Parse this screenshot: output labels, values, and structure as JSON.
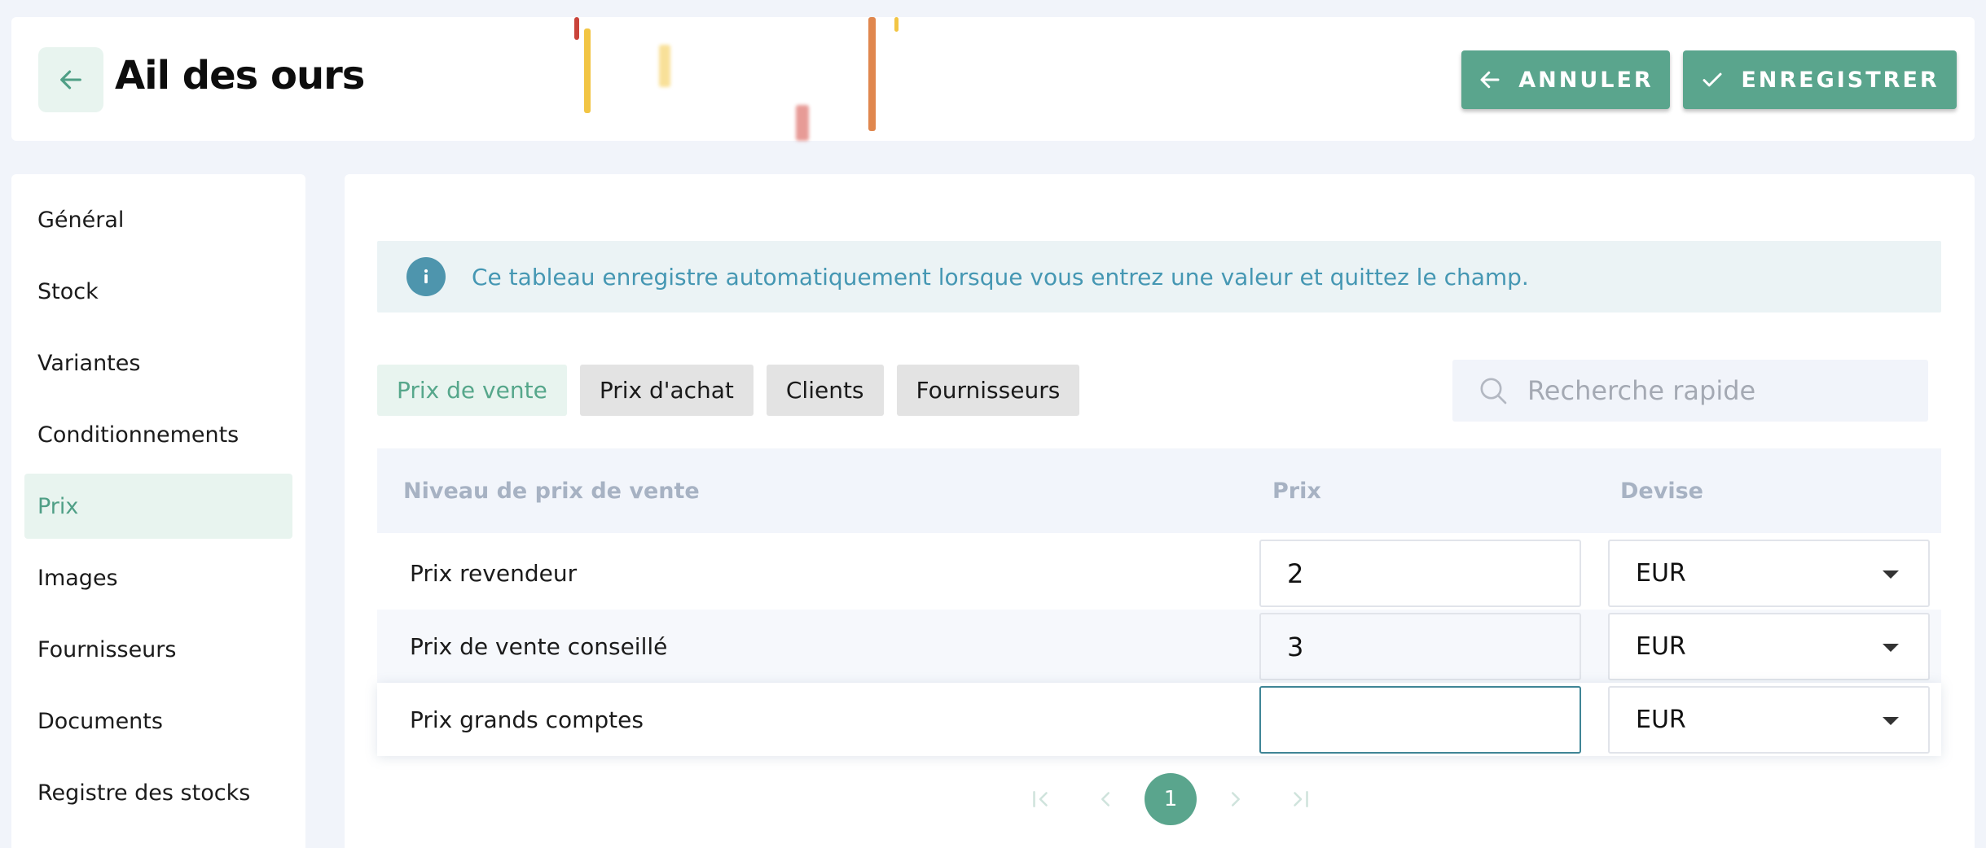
{
  "header": {
    "title": "Ail des ours",
    "cancel_label": "ANNULER",
    "save_label": "ENREGISTRER"
  },
  "sidebar": {
    "items": [
      {
        "label": "Général"
      },
      {
        "label": "Stock"
      },
      {
        "label": "Variantes"
      },
      {
        "label": "Conditionnements"
      },
      {
        "label": "Prix",
        "active": true
      },
      {
        "label": "Images"
      },
      {
        "label": "Fournisseurs"
      },
      {
        "label": "Documents"
      },
      {
        "label": "Registre des stocks"
      }
    ]
  },
  "info": {
    "text": "Ce tableau enregistre automatiquement lorsque vous entrez une valeur et quittez le champ."
  },
  "tabs": [
    {
      "label": "Prix de vente",
      "active": true
    },
    {
      "label": "Prix d'achat"
    },
    {
      "label": "Clients"
    },
    {
      "label": "Fournisseurs"
    }
  ],
  "search": {
    "placeholder": "Recherche rapide",
    "value": ""
  },
  "table": {
    "columns": [
      "Niveau de prix de vente",
      "Prix",
      "Devise"
    ],
    "rows": [
      {
        "level": "Prix revendeur",
        "price": "2",
        "currency": "EUR"
      },
      {
        "level": "Prix de vente conseillé",
        "price": "3",
        "currency": "EUR"
      },
      {
        "level": "Prix grands comptes",
        "price": "",
        "currency": "EUR"
      }
    ]
  },
  "pagination": {
    "current_page": "1"
  },
  "colors": {
    "accent": "#5aa58d",
    "accent_light": "#e8f4ef",
    "info_text": "#4597b3",
    "info_bg": "#ebf3f5"
  },
  "icons": {
    "back": "arrow-left-icon",
    "cancel": "arrow-left-icon",
    "save": "check-icon",
    "info": "info-icon",
    "search": "search-icon",
    "currency": "caret-down-icon",
    "pagination": [
      "first-page-icon",
      "prev-page-icon",
      "next-page-icon",
      "last-page-icon"
    ]
  }
}
